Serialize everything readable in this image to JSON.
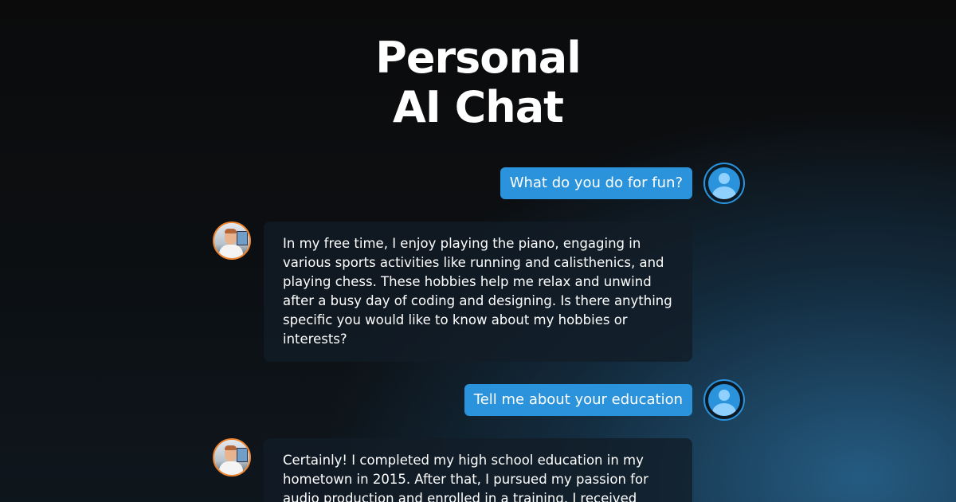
{
  "header": {
    "title_line1": "Personal",
    "title_line2": "AI Chat"
  },
  "messages": [
    {
      "role": "user",
      "text": "What do you do for fun?",
      "avatar_icon": "user-avatar-icon"
    },
    {
      "role": "assistant",
      "text": "In my free time, I enjoy playing the piano, engaging in various sports activities like running and calisthenics, and playing chess. These hobbies help me relax and unwind after a busy day of coding and designing. Is there anything specific you would like to know about my hobbies or interests?",
      "avatar_icon": "profile-photo"
    },
    {
      "role": "user",
      "text": "Tell me about your education",
      "avatar_icon": "user-avatar-icon"
    },
    {
      "role": "assistant",
      "text": "Certainly! I completed my high school education in my hometown in 2015. After that, I pursued my passion for audio production and enrolled in a training. I received",
      "avatar_icon": "profile-photo"
    }
  ],
  "colors": {
    "user_bubble": "#2a93dc",
    "bot_avatar_ring": "#f0852f",
    "background": "#0b0b0c"
  }
}
